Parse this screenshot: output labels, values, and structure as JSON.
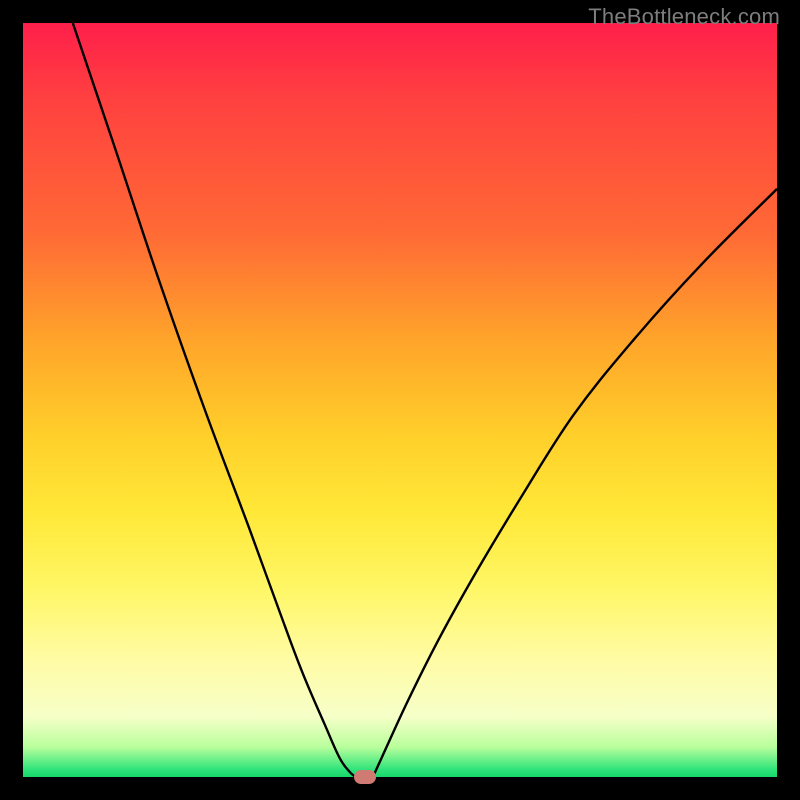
{
  "watermark": "TheBottleneck.com",
  "colors": {
    "frame": "#000000",
    "gradient_top": "#ff1f4b",
    "gradient_bottom": "#16d86b",
    "curve": "#000000",
    "marker": "#cf7a73",
    "watermark_text": "#7d7d7d"
  },
  "chart_data": {
    "type": "line",
    "title": "",
    "xlabel": "",
    "ylabel": "",
    "xlim": [
      0,
      100
    ],
    "ylim": [
      0,
      100
    ],
    "grid": false,
    "legend": false,
    "series": [
      {
        "name": "left-branch",
        "x": [
          6.6,
          12,
          18,
          24,
          30,
          34,
          37,
          40,
          42,
          43.4,
          44.2
        ],
        "y": [
          100,
          84,
          66,
          49,
          33,
          22,
          14,
          7,
          2.5,
          0.6,
          0
        ]
      },
      {
        "name": "right-branch",
        "x": [
          46.4,
          48,
          51,
          55,
          60,
          66,
          73,
          81,
          90,
          100
        ],
        "y": [
          0,
          3.5,
          10,
          18,
          27,
          37,
          48,
          58,
          68,
          78
        ]
      }
    ],
    "marker": {
      "x": 45.3,
      "y": 0,
      "shape": "pill",
      "color": "#cf7a73"
    }
  }
}
